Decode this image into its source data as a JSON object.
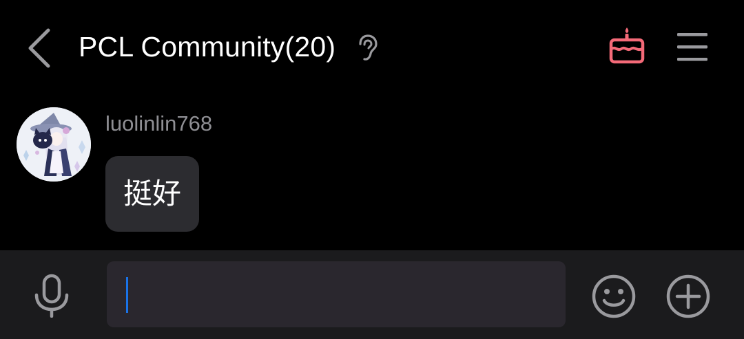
{
  "header": {
    "title": "PCL Community(20)",
    "back_icon": "chevron-left-icon",
    "mode_icon": "ear-icon",
    "cake_icon": "cake-icon",
    "menu_icon": "menu-icon"
  },
  "messages": [
    {
      "sender": "luolinlin768",
      "avatar_icon": "anime-avatar",
      "text": "挺好"
    }
  ],
  "input_bar": {
    "mic_icon": "microphone-icon",
    "value": "",
    "emoji_icon": "smiley-icon",
    "plus_icon": "plus-circle-icon"
  },
  "colors": {
    "background": "#000000",
    "bubble": "#2c2c30",
    "input_bar": "#1b1b1d",
    "input_field": "#2a272e",
    "accent_cake": "#f46a78",
    "caret": "#1a73e8",
    "muted_text": "#8f8f94",
    "icon_gray": "#9a9a9e"
  }
}
